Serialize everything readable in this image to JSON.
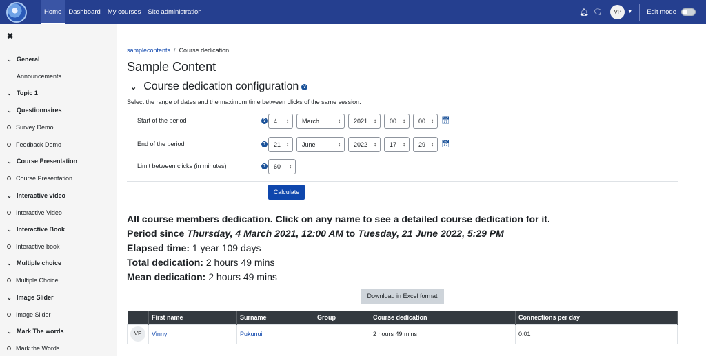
{
  "navbar": {
    "links": [
      "Home",
      "Dashboard",
      "My courses",
      "Site administration"
    ],
    "avatar_initials": "VP",
    "edit_mode_label": "Edit mode"
  },
  "sidebar": {
    "items": [
      {
        "label": "General",
        "type": "section"
      },
      {
        "label": "Announcements",
        "type": "plain"
      },
      {
        "label": "Topic 1",
        "type": "section"
      },
      {
        "label": "Questionnaires",
        "type": "section"
      },
      {
        "label": "Survey Demo",
        "type": "activity"
      },
      {
        "label": "Feedback Demo",
        "type": "activity"
      },
      {
        "label": "Course Presentation",
        "type": "section"
      },
      {
        "label": "Course Presentation",
        "type": "activity"
      },
      {
        "label": "Interactive video",
        "type": "section"
      },
      {
        "label": "Interactive Video",
        "type": "activity"
      },
      {
        "label": "Interactive Book",
        "type": "section"
      },
      {
        "label": "Interactive book",
        "type": "activity"
      },
      {
        "label": "Multiple choice",
        "type": "section"
      },
      {
        "label": "Multiple Choice",
        "type": "activity"
      },
      {
        "label": "Image Slider",
        "type": "section"
      },
      {
        "label": "Image Slider",
        "type": "activity"
      },
      {
        "label": "Mark The words",
        "type": "section"
      },
      {
        "label": "Mark the Words",
        "type": "activity"
      }
    ]
  },
  "breadcrumb": {
    "parent": "samplecontents",
    "current": "Course dedication"
  },
  "page_title": "Sample Content",
  "config": {
    "heading": "Course dedication configuration",
    "description": "Select the range of dates and the maximum time between clicks of the same session.",
    "start": {
      "label": "Start of the period",
      "day": "4",
      "month": "March",
      "year": "2021",
      "hour": "00",
      "minute": "00"
    },
    "end": {
      "label": "End of the period",
      "day": "21",
      "month": "June",
      "year": "2022",
      "hour": "17",
      "minute": "29"
    },
    "limit": {
      "label": "Limit between clicks (in minutes)",
      "value": "60"
    },
    "calculate_label": "Calculate"
  },
  "summary": {
    "headline": "All course members dedication. Click on any name to see a detailed course dedication for it.",
    "period_prefix": "Period since",
    "period_start": "Thursday, 4 March 2021, 12:00 AM",
    "period_to": "to",
    "period_end": "Tuesday, 21 June 2022, 5:29 PM",
    "elapsed_label": "Elapsed time:",
    "elapsed_value": "1 year 109 days",
    "total_label": "Total dedication:",
    "total_value": "2 hours 49 mins",
    "mean_label": "Mean dedication:",
    "mean_value": "2 hours 49 mins",
    "download_label": "Download in Excel format"
  },
  "table": {
    "headers": [
      "",
      "First name",
      "Surname",
      "Group",
      "Course dedication",
      "Connections per day"
    ],
    "rows": [
      {
        "avatar": "VP",
        "first": "Vinny",
        "surname": "Pukunui",
        "group": "",
        "dedication": "2 hours 49 mins",
        "connections": "0.01"
      }
    ]
  }
}
